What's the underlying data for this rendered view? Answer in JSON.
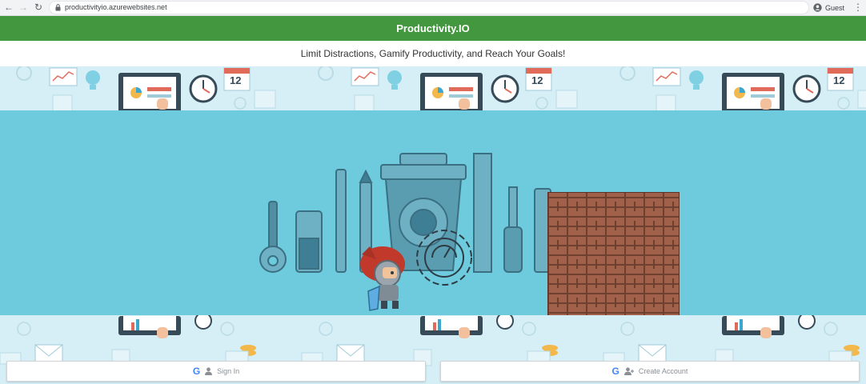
{
  "browser": {
    "url": "productivityio.azurewebsites.net",
    "profile_label": "Guest"
  },
  "site": {
    "title": "Productivity.IO",
    "tagline": "Limit Distractions, Gamify Productivity, and Reach Your Goals!"
  },
  "wallpaper": {
    "calendar_day": "12"
  },
  "auth": {
    "sign_in_label": "Sign In",
    "create_account_label": "Create Account"
  },
  "colors": {
    "header_green": "#43983f",
    "game_bg": "#6ecbdd",
    "wallpaper_bg": "#d6eef6",
    "brick": "#a0604a"
  }
}
